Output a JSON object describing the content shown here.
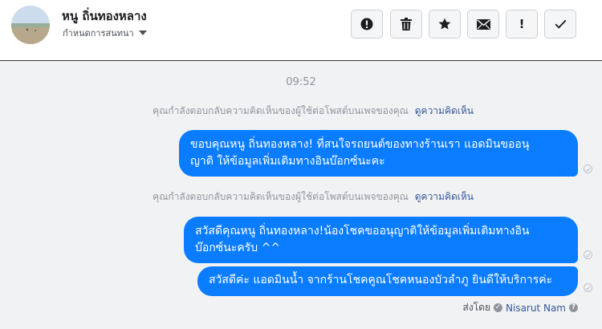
{
  "header": {
    "contact_name": "หนู ถิ่นทองหลาง",
    "assign_label": "กำหนดการสนทนา",
    "actions": [
      {
        "name": "report-button",
        "icon": "alert-circle-icon"
      },
      {
        "name": "delete-button",
        "icon": "trash-icon"
      },
      {
        "name": "star-button",
        "icon": "star-icon"
      },
      {
        "name": "mark-unread-button",
        "icon": "envelope-icon"
      },
      {
        "name": "important-button",
        "icon": "exclamation-icon",
        "label": "!"
      },
      {
        "name": "done-button",
        "icon": "checkmark-icon"
      }
    ]
  },
  "thread": {
    "timestamp": "09:52",
    "notices": [
      {
        "text": "คุณกำลังตอบกลับความคิดเห็นของผู้ใช้ต่อโพสต์บนเพจของคุณ",
        "link": "ดูความคิดเห็น"
      },
      {
        "text": "คุณกำลังตอบกลับความคิดเห็นของผู้ใช้ต่อโพสต์บนเพจของคุณ",
        "link": "ดูความคิดเห็น"
      }
    ],
    "messages": [
      {
        "line1": "ขอบคุณหนู ถิ่นทองหลาง! ที่สนใจรถยนต์ของทางร้านเรา แอดมินขออนุ",
        "line2": "ญาติ ให้ข้อมูลเพิ่มเติมทางอินบ๊อกซ์นะคะ"
      },
      {
        "line1": "สวัสดีคุณหนู ถิ่นทองหลาง!น้องโชคขออนุญาติให้ข้อมูลเพิ่มเติมทางอิน",
        "line2": "บ๊อกซ์นะครับ ^^"
      },
      {
        "line1": "สวัสดีค่ะ แอดมินน้ำ จากร้านโชคคูณโชคหนองบัวลำภู ยินดีให้บริการค่ะ"
      }
    ],
    "sent_by_label": "ส่งโดย",
    "sent_by_name": "Nisarut Nam"
  },
  "colors": {
    "bubble": "#0a7cff",
    "link": "#365899",
    "thread_bg": "#f1f2f4"
  }
}
